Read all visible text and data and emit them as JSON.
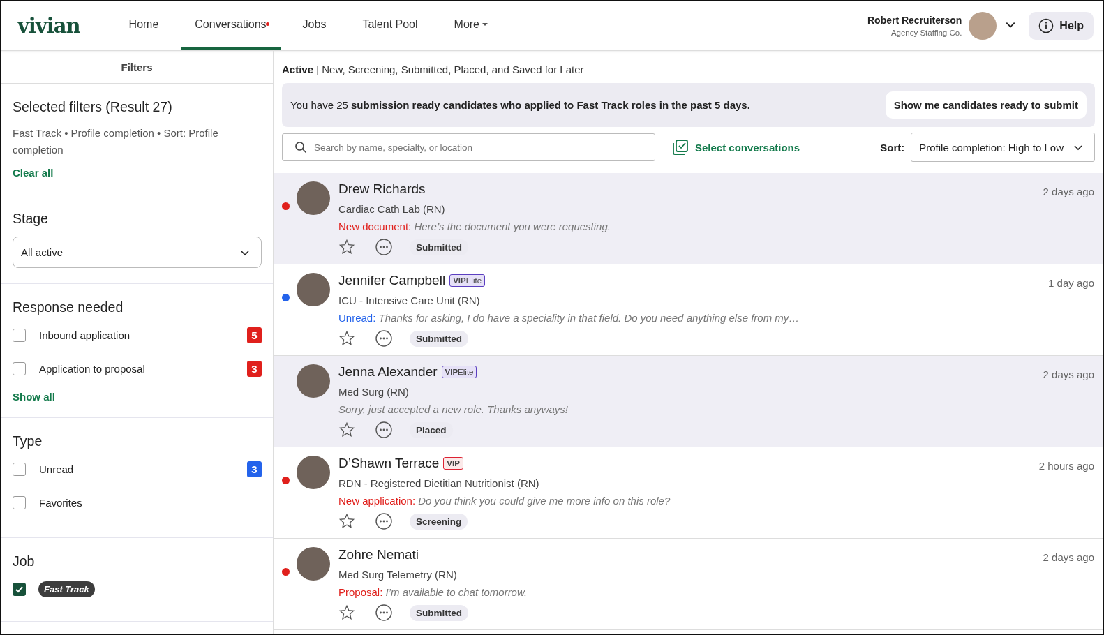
{
  "header": {
    "logo": "vivian",
    "nav": [
      {
        "label": "Home",
        "selected": false,
        "notification": false,
        "dropdown": false
      },
      {
        "label": "Conversations",
        "selected": true,
        "notification": true,
        "dropdown": false
      },
      {
        "label": "Jobs",
        "selected": false,
        "notification": false,
        "dropdown": false
      },
      {
        "label": "Talent Pool",
        "selected": false,
        "notification": false,
        "dropdown": false
      },
      {
        "label": "More",
        "selected": false,
        "notification": false,
        "dropdown": true
      }
    ],
    "user": {
      "name": "Robert Recruiterson",
      "company": "Agency Staffing Co."
    },
    "help": "Help"
  },
  "filters": {
    "title": "Filters",
    "selected_title": "Selected filters (Result 27)",
    "selected_summary": "Fast Track  •  Profile completion •  Sort: Profile completion",
    "clear": "Clear all",
    "stage": {
      "title": "Stage",
      "value": "All active"
    },
    "response": {
      "title": "Response needed",
      "items": [
        {
          "label": "Inbound application",
          "checked": false,
          "count": "5",
          "color": "#e0201c"
        },
        {
          "label": "Application to proposal",
          "checked": false,
          "count": "3",
          "color": "#e0201c"
        }
      ],
      "show_all": "Show all"
    },
    "type": {
      "title": "Type",
      "items": [
        {
          "label": "Unread",
          "checked": false,
          "count": "3",
          "color": "#2463eb"
        },
        {
          "label": "Favorites",
          "checked": false
        }
      ]
    },
    "job": {
      "title": "Job",
      "items": [
        {
          "label": "Fast Track",
          "checked": true
        }
      ]
    }
  },
  "main": {
    "status_label": "Active",
    "separator": "|",
    "status_text": "New, Screening, Submitted, Placed, and Saved for Later",
    "banner": {
      "text": "You have 25 **submission ready candidates who applied to Fast Track roles in the past 5 days.**",
      "button": "Show me candidates ready to submit"
    },
    "search": {
      "placeholder": "Search by name, specialty, or location"
    },
    "select": "Select conversations",
    "sort_label": "Sort:",
    "sort_value": "Profile completion: High to Low",
    "conversations": [
      {
        "name": "Drew Richards",
        "role": "Cardiac Cath Lab (RN)",
        "time": "2 days ago",
        "color": "#e0201c",
        "highlighted": true,
        "prefix": "New document:",
        "message": "Here’s the document you were requesting.",
        "status": "Submitted",
        "favorite": false
      },
      {
        "name": "Jennifer Campbell",
        "badge": {
          "kind": "vip_elite",
          "text": "**VIP**Elite"
        },
        "role": "ICU - Intensive Care Unit (RN)",
        "time": "1 day ago",
        "color": "#2463eb",
        "highlighted": false,
        "prefix": "Unread:",
        "message": "Thanks for asking, I do have a speciality in that field. Do you need anything else from my…",
        "status": "Submitted",
        "favorite": false
      },
      {
        "name": "Jenna Alexander",
        "badge": {
          "kind": "vip_elite",
          "text": "**VIP**Elite"
        },
        "role": "Med Surg (RN)",
        "time": "2 days ago",
        "highlighted": true,
        "message": "Sorry, just accepted a new role. Thanks anyways!",
        "status": "Placed",
        "favorite": false
      },
      {
        "name": "D’Shawn Terrace",
        "badge": {
          "kind": "vip",
          "text": "VIP"
        },
        "role": "RDN - Registered Dietitian Nutritionist (RN)",
        "time": "2 hours ago",
        "color": "#e0201c",
        "highlighted": false,
        "prefix": "New application:",
        "message": "Do you think you could give me more info on this role?",
        "status": "Screening",
        "favorite": false
      },
      {
        "name": "Zohre Nemati",
        "role": "Med Surg Telemetry (RN)",
        "time": "2 days ago",
        "color": "#e0201c",
        "highlighted": false,
        "prefix": "Proposal:",
        "message": "I’m available to chat tomorrow.",
        "status": "Submitted",
        "favorite": false
      }
    ]
  }
}
